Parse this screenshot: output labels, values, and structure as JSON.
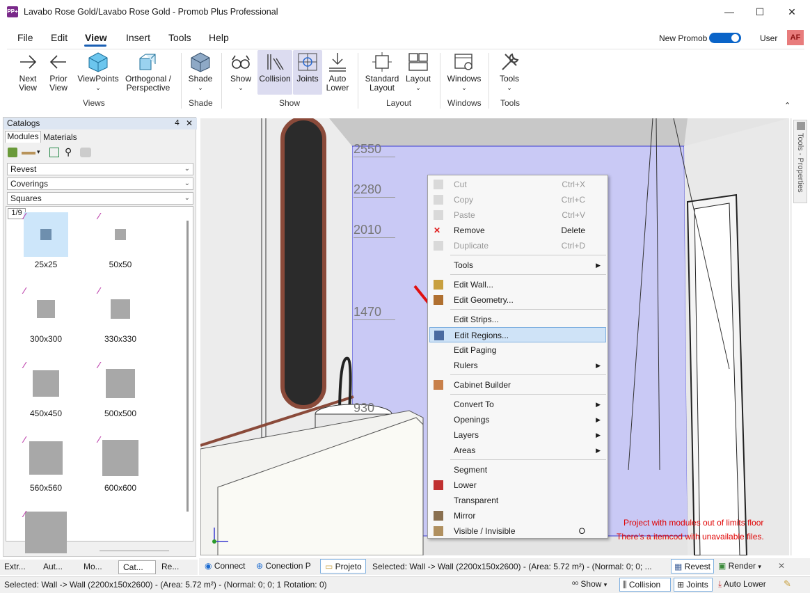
{
  "window": {
    "title": "Lavabo Rose Gold/Lavabo Rose Gold - Promob Plus Professional",
    "icon_label": "PP+"
  },
  "window_controls": {
    "minimize": "—",
    "maximize": "☐",
    "close": "✕"
  },
  "menu": {
    "file": "File",
    "edit": "Edit",
    "view": "View",
    "insert": "Insert",
    "tools": "Tools",
    "help": "Help"
  },
  "header": {
    "new_promob": "New Promob",
    "new_promob_on": true,
    "user": "User",
    "avatar": "AF"
  },
  "ribbon": {
    "next_view": [
      "Next",
      "View"
    ],
    "prior_view": [
      "Prior",
      "View"
    ],
    "viewpoints": "ViewPoints",
    "orthogonal": [
      "Orthogonal /",
      "Perspective"
    ],
    "group_views": "Views",
    "shade": "Shade",
    "group_shade": "Shade",
    "show": "Show",
    "collision": "Collision",
    "joints": "Joints",
    "auto_lower": [
      "Auto",
      "Lower"
    ],
    "group_show": "Show",
    "standard_layout": [
      "Standard",
      "Layout"
    ],
    "layout": "Layout",
    "group_layout": "Layout",
    "windows": "Windows",
    "group_windows": "Windows",
    "tools": "Tools",
    "group_tools": "Tools",
    "collapse": "⌃"
  },
  "catalogs": {
    "title": "Catalogs",
    "pin": "𝟦",
    "close": "✕",
    "tabs": {
      "modules": "Modules",
      "materials": "Materials"
    },
    "filters": [
      "Revest",
      "Coverings",
      "Squares"
    ],
    "page": "1/9",
    "items": [
      {
        "label": "25x25",
        "tile": 16
      },
      {
        "label": "50x50",
        "tile": 16
      },
      {
        "label": "300x300",
        "tile": 26
      },
      {
        "label": "330x330",
        "tile": 28
      },
      {
        "label": "450x450",
        "tile": 38
      },
      {
        "label": "500x500",
        "tile": 42
      },
      {
        "label": "560x560",
        "tile": 48
      },
      {
        "label": "600x600",
        "tile": 52
      },
      {
        "label": "",
        "tile": 60
      }
    ]
  },
  "properties_panel": {
    "label": "Tools - Properties"
  },
  "viewport": {
    "dimensions": [
      "2550",
      "2280",
      "2010",
      "1470",
      "930"
    ],
    "warnings": [
      "Project with modules out of limits floor",
      "There's a itemcod with unavailable files."
    ]
  },
  "context_menu": {
    "items": [
      {
        "label": "Cut",
        "shortcut": "Ctrl+X",
        "disabled": true,
        "icon": "scissors-icon"
      },
      {
        "label": "Copy",
        "shortcut": "Ctrl+C",
        "disabled": true,
        "icon": "copy-icon"
      },
      {
        "label": "Paste",
        "shortcut": "Ctrl+V",
        "disabled": true,
        "icon": "paste-icon"
      },
      {
        "label": "Remove",
        "shortcut": "Delete",
        "disabled": false,
        "icon": "remove-icon"
      },
      {
        "label": "Duplicate",
        "shortcut": "Ctrl+D",
        "disabled": true,
        "icon": "duplicate-icon"
      },
      {
        "label": "Tools",
        "submenu": true
      },
      {
        "label": "Edit Wall...",
        "icon": "edit-wall-icon"
      },
      {
        "label": "Edit Geometry...",
        "icon": "edit-geometry-icon"
      },
      {
        "label": "Edit Strips..."
      },
      {
        "label": "Edit Regions...",
        "highlighted": true,
        "icon": "edit-regions-icon"
      },
      {
        "label": "Edit Paging"
      },
      {
        "label": "Rulers",
        "submenu": true
      },
      {
        "label": "Cabinet Builder",
        "icon": "cabinet-builder-icon"
      },
      {
        "label": "Convert To",
        "submenu": true
      },
      {
        "label": "Openings",
        "submenu": true
      },
      {
        "label": "Layers",
        "submenu": true
      },
      {
        "label": "Areas",
        "submenu": true
      },
      {
        "label": "Segment"
      },
      {
        "label": "Lower",
        "icon": "lower-icon"
      },
      {
        "label": "Transparent"
      },
      {
        "label": "Mirror",
        "icon": "mirror-icon"
      },
      {
        "label": "Visible / Invisible",
        "shortcut": "O",
        "icon": "visible-icon"
      }
    ]
  },
  "bottom_tabs": {
    "left": [
      "Extr...",
      "Aut...",
      "Mo...",
      "Cat...",
      "Re..."
    ],
    "connect": "Connect",
    "conection": "Conection P",
    "projeto": "Projeto",
    "selection": "Selected: Wall -> Wall (2200x150x2600) - (Area: 5.72 m²) - (Normal: 0; 0; ...",
    "revest": "Revest",
    "render": "Render",
    "close": "✕"
  },
  "statusbar": {
    "text": "Selected: Wall -> Wall (2200x150x2600) - (Area: 5.72 m²) - (Normal: 0; 0; 1 Rotation: 0)",
    "show": "Show",
    "collision": "Collision",
    "joints": "Joints",
    "auto_lower": "Auto Lower"
  }
}
